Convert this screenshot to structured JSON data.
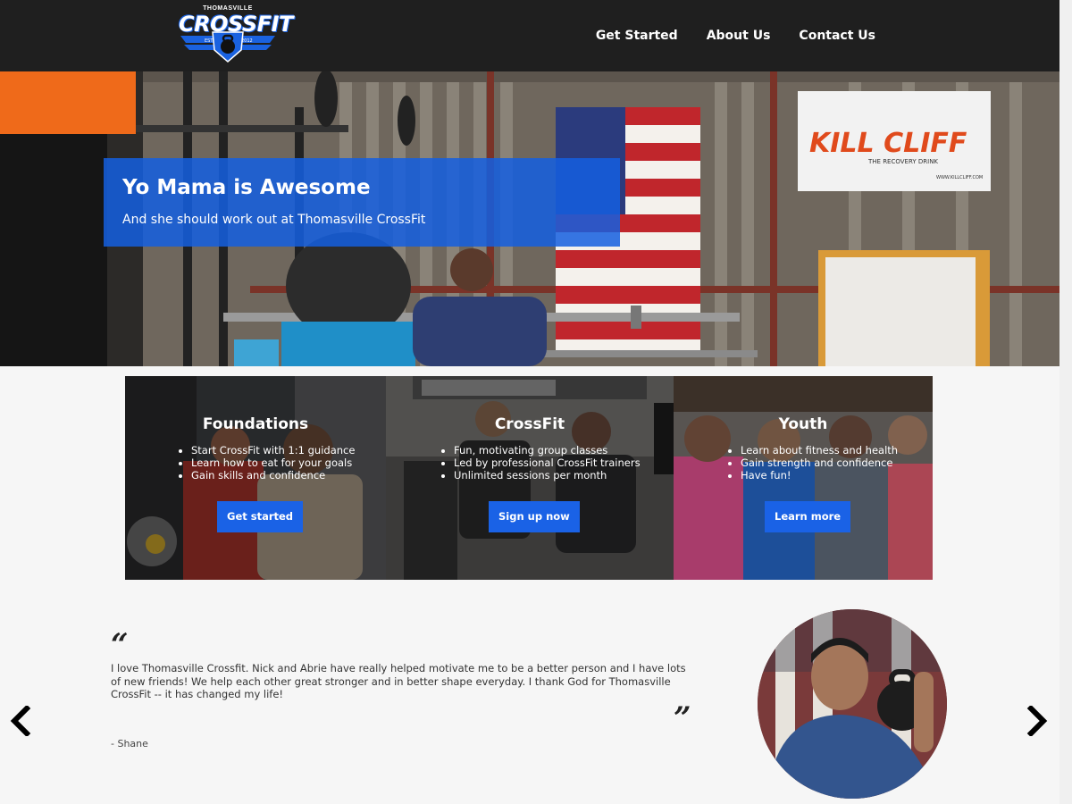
{
  "brand": {
    "logo_top": "THOMASVILLE",
    "logo_main": "CROSSFIT",
    "est": "EST",
    "year": "2012"
  },
  "nav": {
    "items": [
      "Get Started",
      "About Us",
      "Contact Us"
    ]
  },
  "hero": {
    "title": "Yo Mama is Awesome",
    "subtitle": "And she should work out at Thomasville CrossFit",
    "banner_text": "KILL CLIFF",
    "banner_sub": "THE RECOVERY DRINK",
    "banner_url": "WWW.KILLCLIFF.COM"
  },
  "programs": [
    {
      "title": "Foundations",
      "bullets": [
        "Start CrossFit with 1:1 guidance",
        "Learn how to eat for your goals",
        "Gain skills and confidence"
      ],
      "button": "Get started"
    },
    {
      "title": "CrossFit",
      "bullets": [
        "Fun, motivating group classes",
        "Led by professional CrossFit trainers",
        "Unlimited sessions per month"
      ],
      "button": "Sign up now"
    },
    {
      "title": "Youth",
      "bullets": [
        "Learn about fitness and health",
        "Gain strength and confidence",
        "Have fun!"
      ],
      "button": "Learn more"
    }
  ],
  "testimonial": {
    "open_quote": "“",
    "close_quote": "”",
    "text": "I love Thomasville Crossfit. Nick and Abrie have really helped motivate me to be a better person and I have lots of new friends! We help each other great stronger and in better shape everyday. I thank God for Thomasville CrossFit -- it has changed my life!",
    "author": "- Shane"
  },
  "colors": {
    "accent": "#1a62e6",
    "header_bg": "#1f1f1f",
    "page_bg": "#f6f6f6"
  },
  "icons": {
    "prev": "chevron-left-icon",
    "next": "chevron-right-icon"
  }
}
